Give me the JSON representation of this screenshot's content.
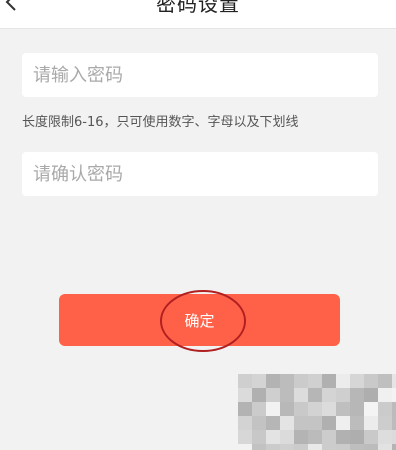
{
  "header": {
    "title": "密码设置"
  },
  "form": {
    "password_placeholder": "请输入密码",
    "password_value": "",
    "hint": "长度限制6-16，只可使用数字、字母以及下划线",
    "confirm_placeholder": "请确认密码",
    "confirm_value": ""
  },
  "actions": {
    "confirm_label": "确定"
  },
  "icons": {
    "back": "chevron-left-icon"
  },
  "colors": {
    "accent": "#ff6148",
    "annotation": "#b02020",
    "background": "#f2f2f2"
  }
}
